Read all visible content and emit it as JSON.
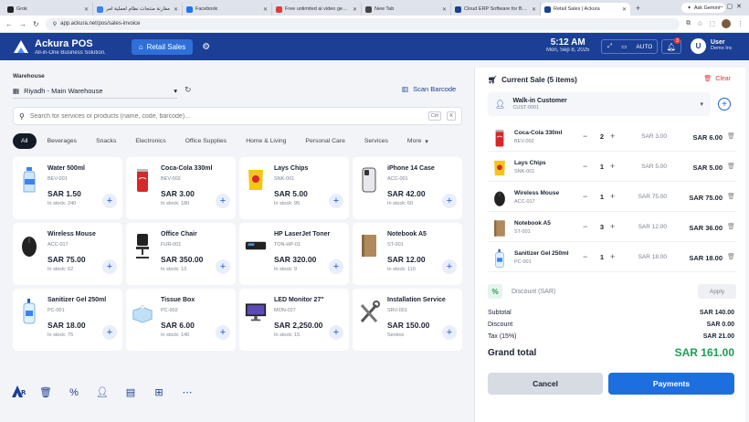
{
  "browser": {
    "tabs": [
      {
        "label": "Grok",
        "color": "#222222"
      },
      {
        "label": "مقارنة منتجات نظام لعملية أمر",
        "color": "#3b82f6"
      },
      {
        "label": "Facebook",
        "color": "#1877f2"
      },
      {
        "label": "Free unlimited ai video generator",
        "color": "#e03a3a"
      },
      {
        "label": "New Tab",
        "color": "#444444"
      },
      {
        "label": "Cloud ERP Software for Business",
        "color": "#1b3f94"
      },
      {
        "label": "Retail Sales | Ackura",
        "color": "#1b3f94"
      }
    ],
    "gemini_label": "Ask Gemini",
    "url": "app.ackura.net/pos/sales-invoice"
  },
  "header": {
    "app_title": "Ackura POS",
    "app_subtitle": "All-in-One Business Solution.",
    "retail_sales_label": "Retail Sales",
    "time": "5:12 AM",
    "date": "Mon, Sep 8, 2025",
    "auto_label": "AUTO",
    "notification_count": "3",
    "user_initial": "U",
    "user_name": "User",
    "user_company": "Demo Inc"
  },
  "left": {
    "warehouse_label": "Warehouse",
    "warehouse_value": "Riyadh - Main Warehouse",
    "scan_label": "Scan Barcode",
    "search_placeholder": "Search for services or products (name, code, barcode)...",
    "shortcut_ctrl": "Ctrl",
    "shortcut_key": "K",
    "categories": [
      {
        "label": "All",
        "active": true
      },
      {
        "label": "Beverages"
      },
      {
        "label": "Snacks"
      },
      {
        "label": "Electronics"
      },
      {
        "label": "Office Supplies"
      },
      {
        "label": "Home & Living"
      },
      {
        "label": "Personal Care"
      },
      {
        "label": "Services"
      },
      {
        "label": "More"
      }
    ],
    "products": [
      {
        "name": "Water 500ml",
        "sku": "BEV-001",
        "price": "SAR 1.50",
        "stock": "In stock: 240",
        "icon": "water-bottle-icon"
      },
      {
        "name": "Coca-Cola 330ml",
        "sku": "BEV-002",
        "price": "SAR 3.00",
        "stock": "In stock: 180",
        "icon": "cola-can-icon"
      },
      {
        "name": "Lays Chips",
        "sku": "SNK-001",
        "price": "SAR 5.00",
        "stock": "In stock: 95",
        "icon": "chips-bag-icon"
      },
      {
        "name": "iPhone 14 Case",
        "sku": "ACC-001",
        "price": "SAR 42.00",
        "stock": "In stock: 60",
        "icon": "phone-case-icon"
      },
      {
        "name": "Wireless Mouse",
        "sku": "ACC-017",
        "price": "SAR 75.00",
        "stock": "In stock: 62",
        "icon": "mouse-icon"
      },
      {
        "name": "Office Chair",
        "sku": "FUR-001",
        "price": "SAR 350.00",
        "stock": "In stock: 13",
        "icon": "chair-icon"
      },
      {
        "name": "HP LaserJet Toner",
        "sku": "TON-HP-01",
        "price": "SAR 320.00",
        "stock": "In stock: 9",
        "icon": "toner-icon"
      },
      {
        "name": "Notebook A5",
        "sku": "ST-001",
        "price": "SAR 12.00",
        "stock": "In stock: 110",
        "icon": "notebook-icon"
      },
      {
        "name": "Sanitizer Gel 250ml",
        "sku": "PC-001",
        "price": "SAR 18.00",
        "stock": "In stock: 75",
        "icon": "sanitizer-icon"
      },
      {
        "name": "Tissue Box",
        "sku": "PC-002",
        "price": "SAR 6.00",
        "stock": "In stock: 140",
        "icon": "tissue-box-icon"
      },
      {
        "name": "LED Monitor 27\"",
        "sku": "MON-027",
        "price": "SAR 2,250.00",
        "stock": "In stock: 15",
        "icon": "monitor-icon"
      },
      {
        "name": "Installation Service",
        "sku": "SRV-001",
        "price": "SAR 150.00",
        "stock": "Service",
        "icon": "tools-icon"
      }
    ]
  },
  "cart": {
    "title": "Current Sale (5 items)",
    "clear_label": "Clear",
    "customer_name": "Walk-in Customer",
    "customer_code": "CUST-0001",
    "items": [
      {
        "name": "Coca-Cola 330ml",
        "sku": "BEV-002",
        "qty": "2",
        "unit": "SAR 3.00",
        "total": "SAR 6.00",
        "icon": "cola-can-icon"
      },
      {
        "name": "Lays Chips",
        "sku": "SNK-001",
        "qty": "1",
        "unit": "SAR 5.00",
        "total": "SAR 5.00",
        "icon": "chips-bag-icon"
      },
      {
        "name": "Wireless Mouse",
        "sku": "ACC-017",
        "qty": "1",
        "unit": "SAR 75.00",
        "total": "SAR 75.00",
        "icon": "mouse-icon"
      },
      {
        "name": "Notebook A5",
        "sku": "ST-001",
        "qty": "3",
        "unit": "SAR 12.00",
        "total": "SAR 36.00",
        "icon": "notebook-icon"
      },
      {
        "name": "Sanitizer Gel 250ml",
        "sku": "PC-001",
        "qty": "1",
        "unit": "SAR 18.00",
        "total": "SAR 18.00",
        "icon": "sanitizer-icon"
      }
    ],
    "discount_icon": "%",
    "discount_label": "Discount (SAR)",
    "apply_label": "Apply",
    "subtotal_label": "Subtotal",
    "subtotal_value": "SAR 140.00",
    "discount_row_label": "Discount",
    "discount_value": "SAR 0.00",
    "tax_label": "Tax (15%)",
    "tax_value": "SAR 21.00",
    "grand_label": "Grand total",
    "grand_value": "SAR 161.00",
    "cancel_label": "Cancel",
    "payments_label": "Payments"
  },
  "colors": {
    "brand": "#1b3f94",
    "accent": "#1d6fe0",
    "success": "#1e9d55",
    "danger": "#e53935"
  }
}
